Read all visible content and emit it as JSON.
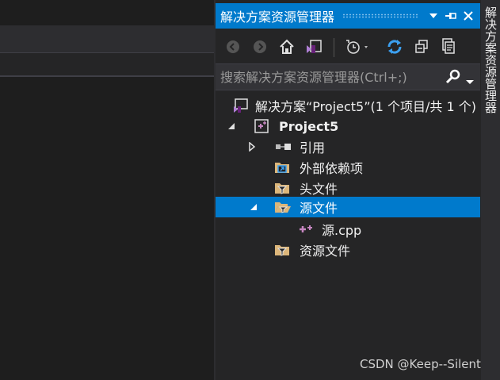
{
  "panel": {
    "title": "解决方案资源管理器",
    "title_buttons": [
      "chevron-down-icon",
      "pin-icon",
      "close-icon"
    ]
  },
  "toolbar": {
    "buttons": [
      "back-icon",
      "forward-icon",
      "home-icon",
      "vs-switch-view-icon",
      "pending-changes-filter-icon",
      "refresh-icon",
      "collapse-all-icon",
      "show-all-files-icon"
    ]
  },
  "search": {
    "placeholder": "搜索解决方案资源管理器(Ctrl+;)"
  },
  "tree": {
    "solution": "解决方案“Project5”(1 个项目/共 1 个)",
    "project": "Project5",
    "references": "引用",
    "external_deps": "外部依赖项",
    "header_files": "头文件",
    "source_files": "源文件",
    "source_cpp": "源.cpp",
    "resource_files": "资源文件"
  },
  "side_tab": {
    "label": "解决方案资源管理器"
  },
  "watermark": "CSDN @Keep--Silent",
  "colors": {
    "accent": "#007acc",
    "background": "#252526",
    "editor": "#1e1e1e",
    "folder": "#dcb67a",
    "cpp": "#c586c0"
  }
}
